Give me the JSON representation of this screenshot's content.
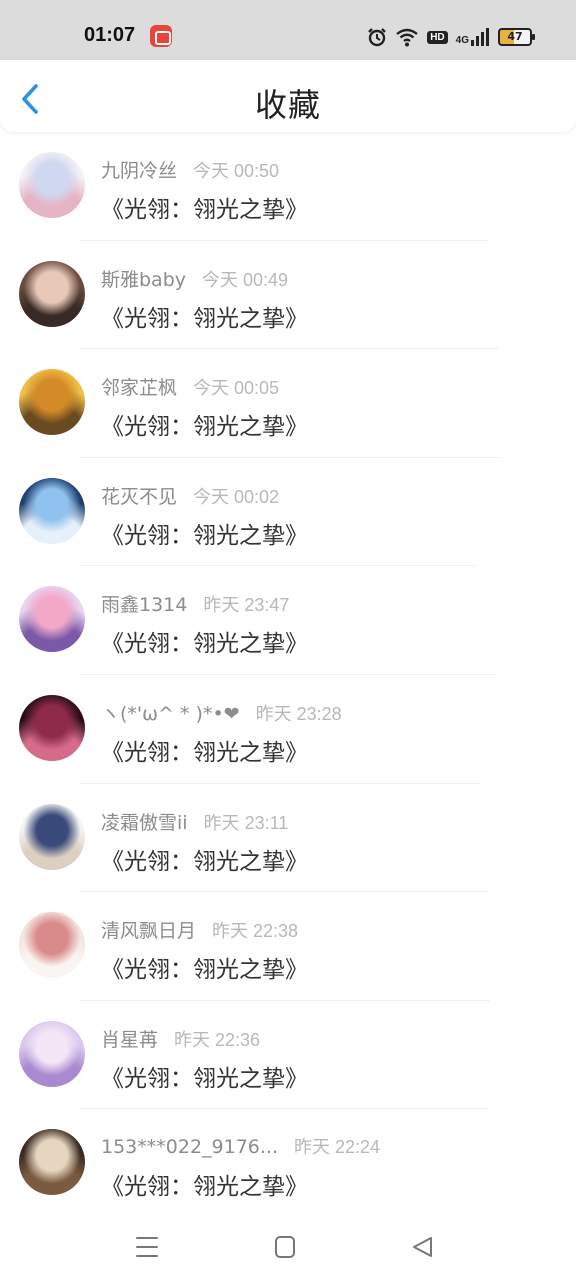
{
  "status": {
    "time": "01:07",
    "hd": "HD",
    "net": "4G",
    "battery": "47"
  },
  "header": {
    "title": "收藏",
    "back_icon": "chevron-left-icon",
    "accent": "#2b93e6"
  },
  "items": [
    {
      "name": "九阴冷丝",
      "time": "今天 00:50",
      "title": "《光翎：翎光之挚》",
      "avatar_colors": [
        "#f4f0f6",
        "#cfd8f0",
        "#e7b3c6"
      ]
    },
    {
      "name": "斯雅baby",
      "time": "今天 00:49",
      "title": "《光翎：翎光之挚》",
      "avatar_colors": [
        "#6b4a3e",
        "#e8c9b8",
        "#3a2a26"
      ]
    },
    {
      "name": "邻家芷枫",
      "time": "今天 00:05",
      "title": "《光翎：翎光之挚》",
      "avatar_colors": [
        "#f0c04a",
        "#d48a26",
        "#6a4a20"
      ]
    },
    {
      "name": "花灭不见",
      "time": "今天 00:02",
      "title": "《光翎：翎光之挚》",
      "avatar_colors": [
        "#1d3f6e",
        "#8fc2ee",
        "#e6f0fa"
      ]
    },
    {
      "name": "雨鑫1314",
      "time": "昨天 23:47",
      "title": "《光翎：翎光之挚》",
      "avatar_colors": [
        "#e7d6f3",
        "#f3a8c8",
        "#7a5aa8"
      ]
    },
    {
      "name": "ヽ(*'ω^ * )*•❤",
      "time": "昨天 23:28",
      "title": "《光翎：翎光之挚》",
      "avatar_colors": [
        "#2a0d18",
        "#8e2b4a",
        "#d56a8a"
      ]
    },
    {
      "name": "凌霜傲雪ii",
      "time": "昨天 23:11",
      "title": "《光翎：翎光之挚》",
      "avatar_colors": [
        "#f3f3f3",
        "#3a4a7a",
        "#dcd0c2"
      ]
    },
    {
      "name": "清风飘日月",
      "time": "昨天 22:38",
      "title": "《光翎：翎光之挚》",
      "avatar_colors": [
        "#f4e4e0",
        "#d98a8a",
        "#faf5f2"
      ]
    },
    {
      "name": "肖星苒",
      "time": "昨天 22:36",
      "title": "《光翎：翎光之挚》",
      "avatar_colors": [
        "#d9c8ee",
        "#f4e6f6",
        "#a98ad0"
      ]
    },
    {
      "name": "153***022_9176...",
      "time": "昨天 22:24",
      "title": "《光翎：翎光之挚》",
      "avatar_colors": [
        "#3a2a22",
        "#e6d6bf",
        "#7a5a40"
      ]
    }
  ],
  "navbar": {
    "menu_icon": "menu-icon",
    "home_icon": "square-home-icon",
    "back_icon": "triangle-back-icon"
  }
}
